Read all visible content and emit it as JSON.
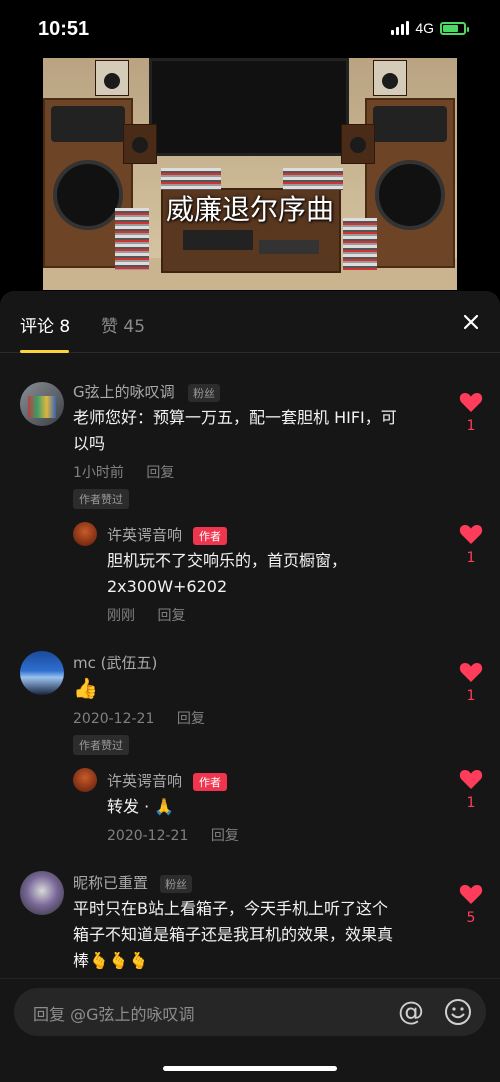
{
  "status_bar": {
    "time": "10:51",
    "network": "4G"
  },
  "video": {
    "title": "威廉退尔序曲"
  },
  "tabs": [
    {
      "label": "评论 8",
      "active": true
    },
    {
      "label": "赞 45",
      "active": false
    }
  ],
  "comments": [
    {
      "name": "G弦上的咏叹调",
      "badge": "粉丝",
      "text_lines": [
        "老师您好：预算一万五，配一套胆机 HIFI，可",
        "以吗"
      ],
      "time": "1小时前",
      "reply": "回复",
      "author_liked": "作者赞过",
      "likes": "1",
      "replies": [
        {
          "name": "许英谔音响",
          "badge": "作者",
          "text_lines": [
            "胆机玩不了交响乐的，首页橱窗，",
            "2x300W+6202"
          ],
          "time": "刚刚",
          "reply": "回复",
          "likes": "1"
        }
      ]
    },
    {
      "name": "mc (武伍五)",
      "text_lines": [
        "👍"
      ],
      "time": "2020-12-21",
      "reply": "回复",
      "author_liked": "作者赞过",
      "likes": "1",
      "replies": [
        {
          "name": "许英谔音响",
          "badge": "作者",
          "text_lines": [
            "转发 · 🙏"
          ],
          "time": "2020-12-21",
          "reply": "回复",
          "likes": "1"
        }
      ]
    },
    {
      "name": "昵称已重置",
      "badge": "粉丝",
      "text_lines": [
        "平时只在B站上看箱子，今天手机上听了这个",
        "箱子不知道是箱子还是我耳机的效果，效果真",
        "棒🫰🫰🫰"
      ],
      "likes": "5"
    }
  ],
  "reply_input": {
    "placeholder": "回复 @G弦上的咏叹调"
  },
  "icons": {
    "close": "close-icon",
    "heart": "heart-icon",
    "at": "at-icon",
    "emoji": "emoji-icon",
    "signal": "signal-icon",
    "battery": "battery-icon"
  },
  "colors": {
    "accent_tab": "#fcd33c",
    "like": "#ff3d5a",
    "author_badge": "#f0364e",
    "panel_bg": "#161616"
  }
}
